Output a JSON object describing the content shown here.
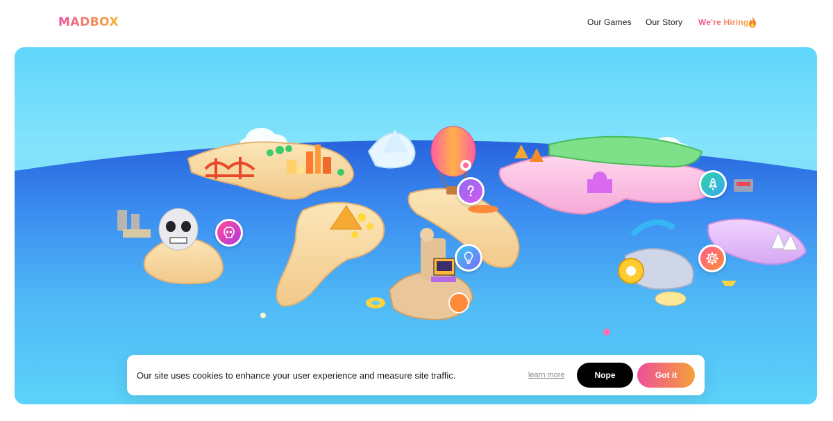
{
  "header": {
    "logo": "MADBOX",
    "nav": [
      {
        "label": "Our Games"
      },
      {
        "label": "Our Story"
      },
      {
        "label": "We're Hiring"
      }
    ],
    "hiring_icon": "fire-icon"
  },
  "hero": {
    "badges": [
      {
        "icon": "skull-icon"
      },
      {
        "icon": "question-icon"
      },
      {
        "icon": "lightbulb-icon"
      },
      {
        "icon": "rocket-icon"
      },
      {
        "icon": "gear-icon"
      }
    ]
  },
  "cookie_banner": {
    "message": "Our site uses cookies to enhance your user experience and measure site traffic.",
    "learn_more": "learn more",
    "decline_label": "Nope",
    "accept_label": "Got it"
  },
  "colors": {
    "brand_pink": "#ee4f9a",
    "brand_orange": "#f5a03a",
    "ocean_blue": "#2f6fe0",
    "sky_blue": "#84e3fb"
  }
}
